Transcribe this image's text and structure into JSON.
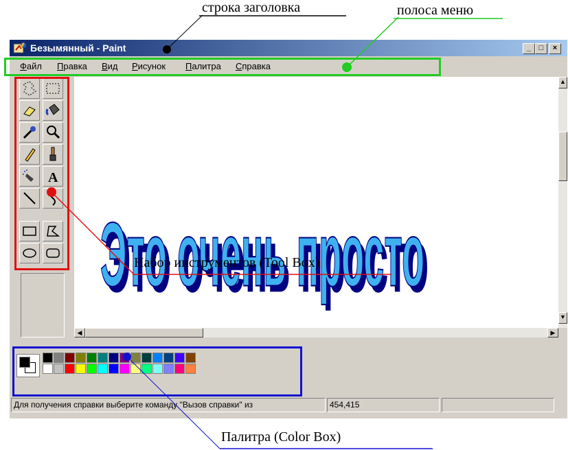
{
  "window": {
    "title": "Безымянный - Paint",
    "controls": [
      "_",
      "□",
      "×"
    ]
  },
  "menu": {
    "items": [
      {
        "underline": "Ф",
        "rest": "айл"
      },
      {
        "underline": "П",
        "rest": "равка"
      },
      {
        "underline": "В",
        "rest": "ид"
      },
      {
        "underline": "Р",
        "rest": "исунок"
      },
      {
        "underline": "П",
        "rest": "алитра"
      },
      {
        "underline": "С",
        "rest": "правка"
      }
    ]
  },
  "toolbox": {
    "tools": [
      "free-select-icon",
      "rect-select-icon",
      "eraser-icon",
      "fill-bucket-icon",
      "color-picker-icon",
      "magnifier-icon",
      "pencil-icon",
      "brush-icon",
      "airbrush-icon",
      "text-tool-icon",
      "line-icon",
      "curve-icon",
      "rectangle-icon",
      "polygon-icon",
      "ellipse-icon",
      "rounded-rect-icon"
    ],
    "text_tool_glyph": "A"
  },
  "canvas": {
    "wordart_text": "Это очень просто",
    "wordart_fill": "#3fb1f0",
    "wordart_shadow": "#000080"
  },
  "palette": {
    "foreground": "#000000",
    "background": "#ffffff",
    "row1": [
      "#000000",
      "#808080",
      "#800000",
      "#808000",
      "#008000",
      "#008080",
      "#000080",
      "#800080",
      "#808040",
      "#004040",
      "#0080ff",
      "#004080",
      "#4000ff",
      "#804000"
    ],
    "row2": [
      "#ffffff",
      "#c0c0c0",
      "#ff0000",
      "#ffff00",
      "#00ff00",
      "#00ffff",
      "#0000ff",
      "#ff00ff",
      "#ffff80",
      "#00ff80",
      "#80ffff",
      "#8080ff",
      "#ff0080",
      "#ff8040"
    ]
  },
  "status": {
    "help_text": "Для получения справки выберите команду \"Вызов справки\" из",
    "coords": "454,415"
  },
  "annotations": {
    "title_bar": "строка заголовка",
    "menu_bar": "полоса меню",
    "toolbox": "Набор инструментов (Tool Box)",
    "palette": "Палитра (Color Box)",
    "colors": {
      "title": "#000000",
      "menu": "#22cc22",
      "toolbox": "#e01010",
      "palette": "#1010d0"
    }
  }
}
